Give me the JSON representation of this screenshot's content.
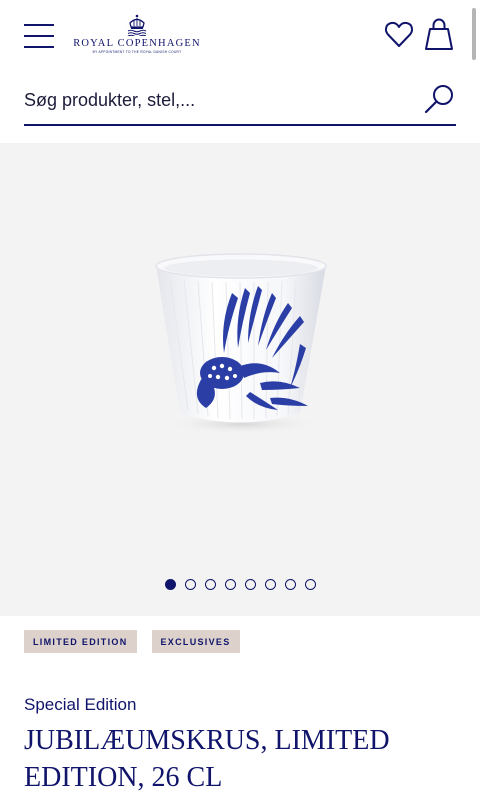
{
  "header": {
    "brand_name": "ROYAL COPENHAGEN",
    "brand_tagline": "BY APPOINTMENT TO THE ROYAL DANISH COURT",
    "icons": [
      "menu-icon",
      "crown-icon",
      "heart-icon",
      "shopping-bag-icon"
    ]
  },
  "search": {
    "placeholder": "Søg produkter, stel,...",
    "icon": "search-icon"
  },
  "gallery": {
    "total_images": 8,
    "active_index": 0
  },
  "badges": [
    "LIMITED EDITION",
    "EXCLUSIVES"
  ],
  "product": {
    "edition": "Special Edition",
    "title": "JUBILÆUMSKRUS, LIMITED EDITION, 26 CL"
  },
  "colors": {
    "brand_navy": "#10146a",
    "badge_bg": "#dcd1cb",
    "gallery_bg": "#f3f3f3",
    "pattern_blue": "#2b3ea6"
  }
}
